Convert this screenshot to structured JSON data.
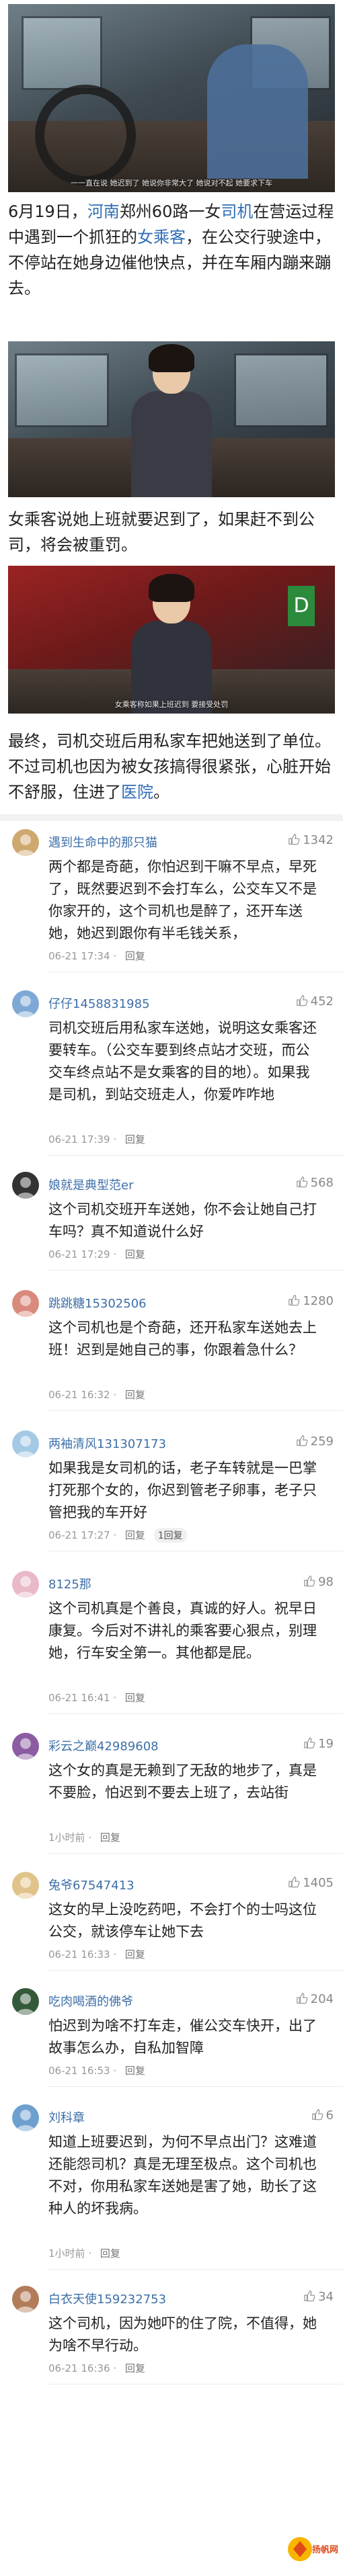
{
  "article": {
    "photo1_caption": "一一直在说 她迟到了 她说你非常大了 她说对不起 她要求下车",
    "paragraph1_parts": [
      "6月19日，",
      "河南",
      "郑州60路一女",
      "司机",
      "在营运过程中遇到一个抓狂的",
      "女乘客",
      "，在公交行驶途中，不停站在她身边催他快点，并在车厢内蹦来蹦去。"
    ],
    "paragraph2": "女乘客说她上班就要迟到了，如果赶不到公司，将会被重罚。",
    "photo3_caption": "女乘客称如果上班迟到 要接受处罚",
    "paragraph3_parts": [
      "最终，司机交班后用私家车把她送到了单位。不过司机也因为被女孩搞得很紧张，心脏开始不舒服，住进了",
      "医院",
      "。"
    ]
  },
  "colors": {
    "link": "#2f6db5",
    "username": "#3d6fa8",
    "meta": "#999999"
  },
  "comments": [
    {
      "username": "遇到生命中的那只猫",
      "likes": "1342",
      "text": "两个都是奇葩，你怕迟到干嘛不早点，早死了，既然要迟到不会打车么，公交车又不是你家开的，这个司机也是醉了，还开车送她，她迟到跟你有半毛钱关系，",
      "time": "06-21 17:34",
      "reply": "回复"
    },
    {
      "username": "仔仔1458831985",
      "likes": "452",
      "text": "司机交班后用私家车送她，说明这女乘客还要转车。（公交车要到终点站才交班，而公交车终点站不是女乘客的目的地）。如果我是司机，到站交班走人，你爱咋咋地",
      "time": "06-21 17:39",
      "reply": "回复"
    },
    {
      "username": "娘就是典型范er",
      "likes": "568",
      "text": "这个司机交班开车送她，你不会让她自己打车吗？真不知道说什么好",
      "time": "06-21 17:29",
      "reply": "回复"
    },
    {
      "username": "跳跳糖15302506",
      "likes": "1280",
      "text": "这个司机也是个奇葩，还开私家车送她去上班！迟到是她自己的事，你跟着急什么？",
      "time": "06-21 16:32",
      "reply": "回复"
    },
    {
      "username": "两袖清风131307173",
      "likes": "259",
      "text": "如果我是女司机的话，老子车转就是一巴掌打死那个女的，你迟到管老子卵事，老子只管把我的车开好",
      "time": "06-21 17:27",
      "reply": "回复",
      "reply_count": "1回复"
    },
    {
      "username": "8125那",
      "likes": "98",
      "text": "这个司机真是个善良，真诚的好人。祝早日康复。今后对不讲礼的乘客要心狠点，别理她，行车安全第一。其他都是屁。",
      "time": "06-21 16:41",
      "reply": "回复"
    },
    {
      "username": "彩云之巅42989608",
      "likes": "19",
      "text": "这个女的真是无赖到了无敌的地步了，真是不要脸，怕迟到不要去上班了，去站街",
      "time": "1小时前",
      "reply": "回复"
    },
    {
      "username": "兔爷67547413",
      "likes": "1405",
      "text": "这女的早上没吃药吧，不会打个的士吗这位公交，就该停车让她下去",
      "time": "06-21 16:33",
      "reply": "回复"
    },
    {
      "username": "吃肉喝酒的佛爷",
      "likes": "204",
      "text": "怕迟到为啥不打车走，催公交车快开，出了故事怎么办，自私加智障",
      "time": "06-21 16:53",
      "reply": "回复"
    },
    {
      "username": "刘科章",
      "likes": "6",
      "text": "知道上班要迟到，为何不早点出门？这难道还能怨司机？真是无理至极点。这个司机也不对，你用私家车送她是害了她，助长了这种人的坏我病。",
      "time": "1小时前",
      "reply": "回复"
    },
    {
      "username": "白衣天使159232753",
      "likes": "34",
      "text": "这个司机，因为她吓的住了院，不值得，她为啥不早行动。",
      "time": "06-21 16:36",
      "reply": "回复"
    }
  ],
  "watermark": {
    "label": "扬帆网"
  }
}
